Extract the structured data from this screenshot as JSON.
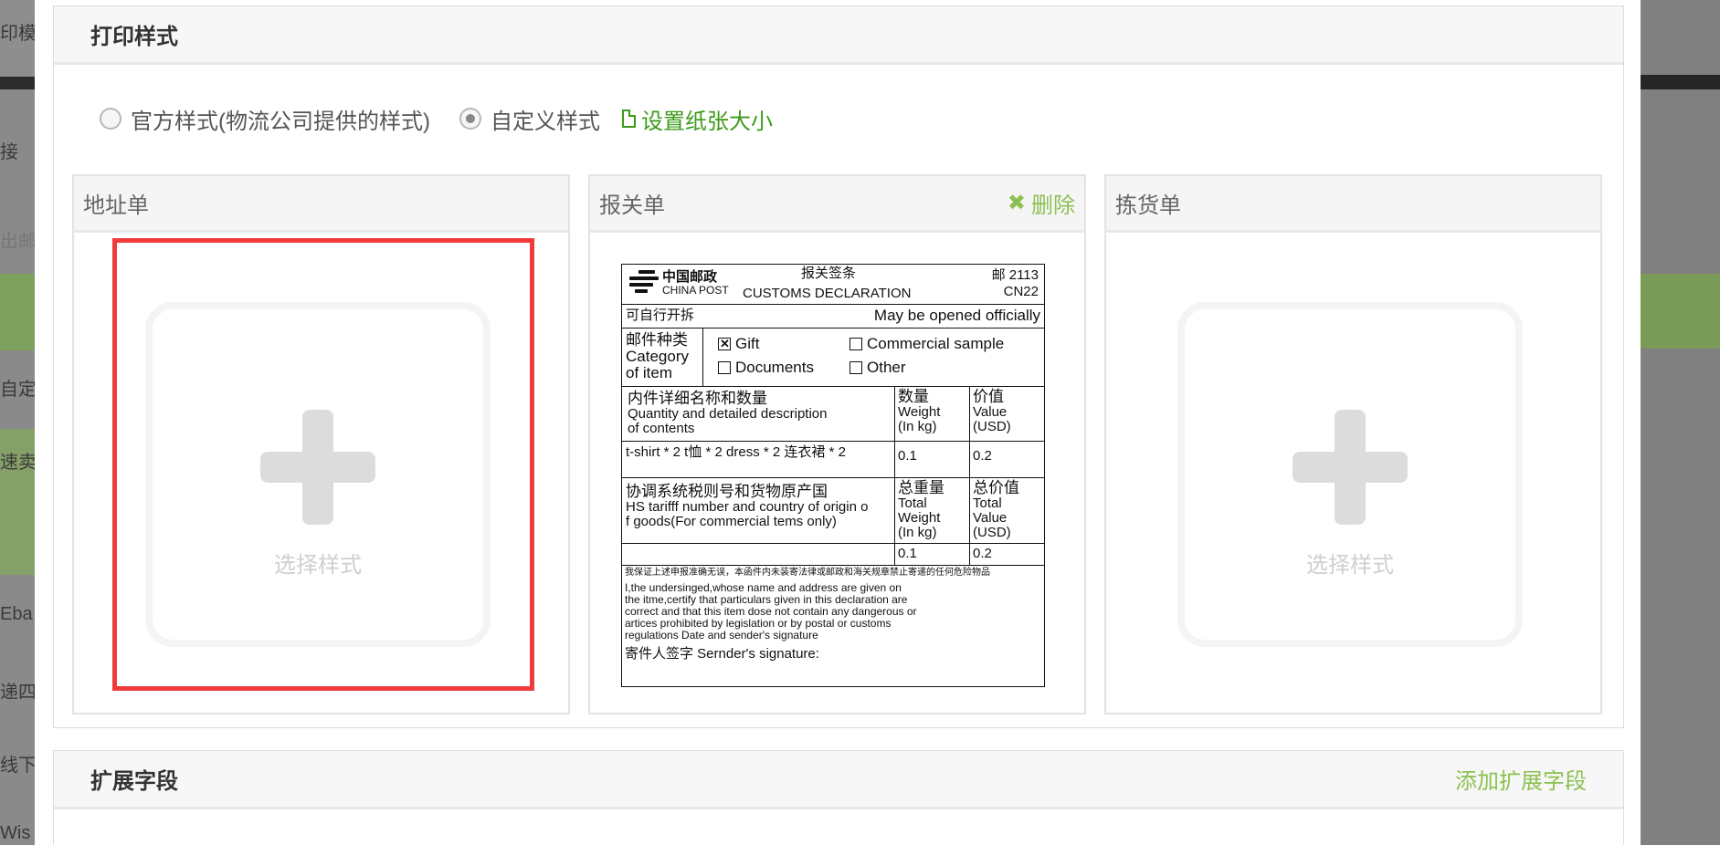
{
  "background": {
    "left_fragments": [
      "印模",
      "接",
      "出邮",
      "自定",
      "速卖",
      "Eba",
      "递四",
      "线下",
      "Wis"
    ]
  },
  "print_style": {
    "title": "打印样式",
    "options": [
      {
        "label": "官方样式(物流公司提供的样式)",
        "checked": false
      },
      {
        "label": "自定义样式",
        "checked": true
      }
    ],
    "paper_size_link": "设置纸张大小"
  },
  "cards": {
    "address": {
      "title": "地址单",
      "placeholder": "选择样式"
    },
    "customs": {
      "title": "报关单",
      "delete_label": "删除"
    },
    "picking": {
      "title": "拣货单",
      "placeholder": "选择样式"
    }
  },
  "customs_form": {
    "logo_cn": "中国邮政",
    "logo_en": "CHINA POST",
    "header_cn": "报关签条",
    "header_en": "CUSTOMS DECLARATION",
    "code1": "邮 2113",
    "code2": "CN22",
    "open_cn": "可自行开拆",
    "open_en": "May be opened officially",
    "category_cn": "邮件种类",
    "category_en1": "Category",
    "category_en2": "of item",
    "gift": "Gift",
    "commercial": "Commercial sample",
    "documents": "Documents",
    "other": "Other",
    "contents_cn": "内件详细名称和数量",
    "contents_en1": "Quantity and detailed description",
    "contents_en2": "of contents",
    "weight_cn": "数量",
    "weight_en1": "Weight",
    "weight_en2": "(In kg)",
    "value_cn": "价值",
    "value_en1": "Value",
    "value_en2": "(USD)",
    "item_desc": "t-shirt * 2 t恤 * 2 dress * 2 连衣裙 * 2",
    "item_weight": "0.1",
    "item_value": "0.2",
    "hs_cn": "协调系统税则号和货物原产国",
    "hs_en1": "HS tarifff number and country of origin o",
    "hs_en2": "f goods(For commercial tems only)",
    "total_weight_cn": "总重量",
    "total_weight_en1": "Total",
    "total_weight_en2": "Weight",
    "total_weight_en3": "(In kg)",
    "total_value_cn": "总价值",
    "total_value_en1": "Total",
    "total_value_en2": "Value",
    "total_value_en3": "(USD)",
    "total_weight": "0.1",
    "total_value": "0.2",
    "declaration_cn": "我保证上述申报准确无误，本函件内未装寄法律或邮政和海关规章禁止寄递的任何危险物品",
    "declaration_en1": "I,the undersinged,whose name and address are given on",
    "declaration_en2": "the itme,certify that particulars given in this declaration are",
    "declaration_en3": "correct and that this item dose not contain any dangerous or",
    "declaration_en4": " artices prohibited by legislation or by postal or customs",
    "declaration_en5": "regulations Date and sender's signature",
    "signature": "寄件人签字 Sernder's signature:"
  },
  "extension": {
    "title": "扩展字段",
    "add_link": "添加扩展字段"
  }
}
